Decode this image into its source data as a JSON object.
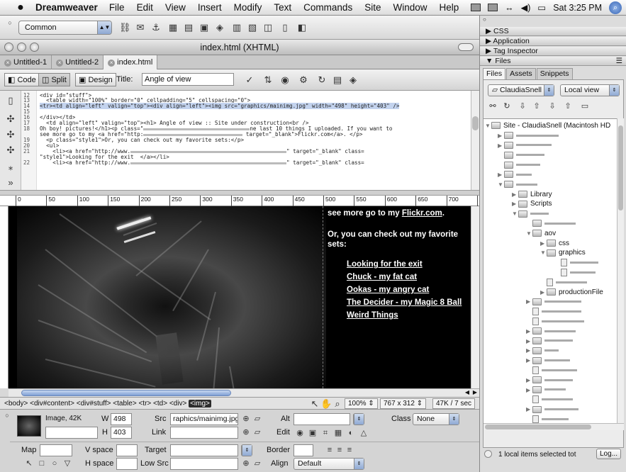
{
  "menubar": {
    "app_name": "Dreamweaver",
    "items": [
      "File",
      "Edit",
      "View",
      "Insert",
      "Modify",
      "Text",
      "Commands",
      "Site",
      "Window",
      "Help"
    ],
    "clock": "Sat 3:25 PM"
  },
  "insert_bar": {
    "category": "Common"
  },
  "document": {
    "window_title": "index.html (XHTML)",
    "tabs": [
      "Untitled-1",
      "Untitled-2",
      "index.html"
    ],
    "active_tab": "index.html",
    "view_buttons": {
      "code": "Code",
      "split": "Split",
      "design": "Design"
    },
    "title_label": "Title:",
    "title_value": "Angle of view"
  },
  "code": {
    "line_numbers": [
      "12",
      "13",
      "14",
      "15",
      "16",
      "17",
      "18",
      "",
      "19",
      "20",
      "21",
      "",
      "22"
    ],
    "lines": [
      "<div id=\"stuff\">",
      "  <table width=\"100%\" border=\"0\" cellpadding=\"5\" cellspacing=\"0\">",
      "<tr><td align=\"left\" valign=\"top\"><div align=\"left\"><img src=\"graphics/mainimg.jpg\" width=\"498\" height=\"403\" />",
      "",
      "</div></td>",
      "  <td align=\"left\" valign=\"top\"><h1> Angle of view :: Site under construction<br />",
      "Oh boy! pictures!</h1><p class=\"",
      "see more go to my <a href=\"http:",
      "  <p class=\"style1\">Or, you can check out my favorite sets:</p>",
      "  <ul>",
      "    <li><a href=\"http://www.",
      "\"style1\">Looking for the exit  </a></li>",
      "    <li><a href=\"http://www."
    ],
    "line_tails": [
      "",
      "",
      "",
      "",
      "",
      "",
      "ne last 10 things I uploaded. If you want to",
      " target=\"_blank\">Flickr.com</a>. </p>",
      "",
      "",
      "\" target=\"_blank\" class=",
      "",
      "\" target=\"_blank\" class="
    ]
  },
  "ruler": [
    "0",
    "50",
    "100",
    "150",
    "200",
    "250",
    "300",
    "350",
    "400",
    "450",
    "500",
    "550",
    "600",
    "650",
    "700",
    "75"
  ],
  "design": {
    "intro_line": "see more go to my",
    "flickr_link": "Flickr.com",
    "intro_end": ".",
    "sets_line1": "Or, you can check out my favorite",
    "sets_line2": "sets:",
    "links": [
      "Looking for the exit",
      "Chuck - my fat cat",
      "Ookas - my angry cat",
      "The Decider - my Magic 8 Ball",
      "Weird Things"
    ]
  },
  "status_bar": {
    "tags": [
      "<body>",
      "<div#content>",
      "<div#stuff>",
      "<table>",
      "<tr>",
      "<td>",
      "<div>"
    ],
    "selected_tag": "<img>",
    "zoom": "100%",
    "window_size": "767 x 312",
    "download": "47K / 7 sec"
  },
  "properties": {
    "type_label": "Image, 42K",
    "w_label": "W",
    "w_value": "498",
    "h_label": "H",
    "h_value": "403",
    "src_label": "Src",
    "src_value": "raphics/mainimg.jpg",
    "link_label": "Link",
    "link_value": "",
    "alt_label": "Alt",
    "alt_value": "",
    "edit_label": "Edit",
    "class_label": "Class",
    "class_value": "None",
    "map_label": "Map",
    "map_value": "",
    "vspace_label": "V space",
    "vspace_value": "",
    "hspace_label": "H space",
    "hspace_value": "",
    "target_label": "Target",
    "target_value": "",
    "lowsrc_label": "Low Src",
    "lowsrc_value": "",
    "border_label": "Border",
    "border_value": "",
    "align_label": "Align",
    "align_value": "Default"
  },
  "panels": {
    "groups": [
      "CSS",
      "Application",
      "Tag Inspector",
      "Files"
    ],
    "files_tabs": [
      "Files",
      "Assets",
      "Snippets"
    ],
    "site_select": "ClaudiaSnell",
    "view_select": "Local view",
    "site_root": "Site - ClaudiaSnell (Macintosh HD",
    "folders": [
      "Library",
      "Scripts",
      "aov",
      "css",
      "graphics",
      "productionFile"
    ],
    "status": "1 local items selected tot",
    "log_button": "Log..."
  }
}
